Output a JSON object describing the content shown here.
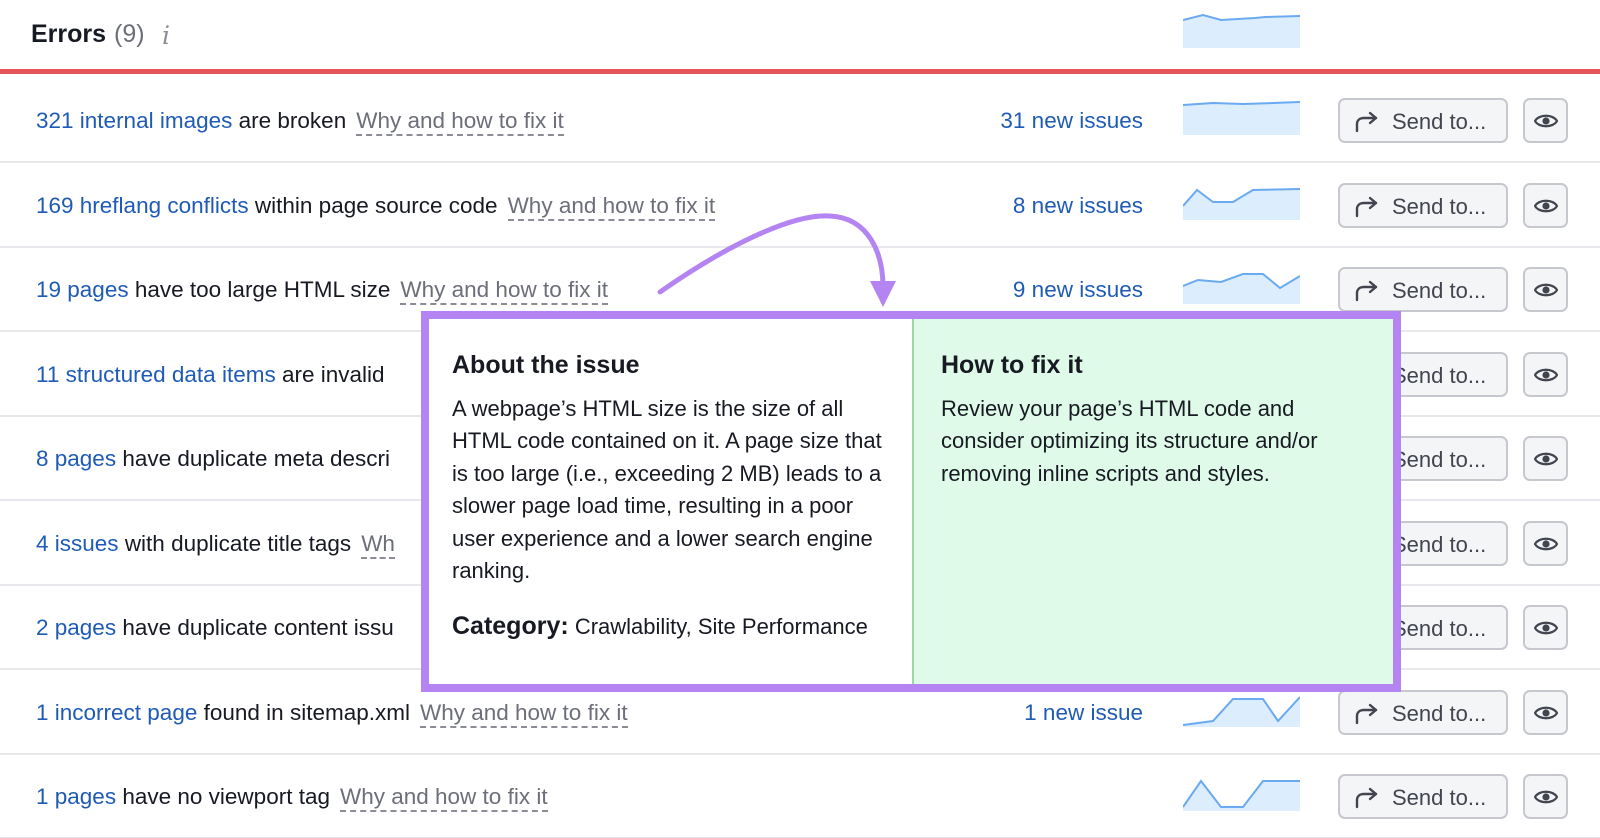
{
  "header": {
    "title": "Errors",
    "count": "(9)",
    "info_glyph": "i"
  },
  "rows": [
    {
      "link": "321 internal images",
      "text": "are broken",
      "why": "Why and how to fix it",
      "issues": "31 new issues",
      "send": "Send to..."
    },
    {
      "link": "169 hreflang conflicts",
      "text": "within page source code",
      "why": "Why and how to fix it",
      "issues": "8 new issues",
      "send": "Send to..."
    },
    {
      "link": "19 pages",
      "text": "have too large HTML size",
      "why": "Why and how to fix it",
      "issues": "9 new issues",
      "send": "Send to..."
    },
    {
      "link": "11 structured data items",
      "text": "are invalid",
      "why": "",
      "issues": "",
      "send": "Send to..."
    },
    {
      "link": "8 pages",
      "text": "have duplicate meta descri",
      "why": "",
      "issues": "",
      "send": "Send to..."
    },
    {
      "link": "4 issues",
      "text": "with duplicate title tags",
      "why": "Wh",
      "issues": "",
      "send": "Send to..."
    },
    {
      "link": "2 pages",
      "text": "have duplicate content issu",
      "why": "",
      "issues": "",
      "send": "Send to..."
    },
    {
      "link": "1 incorrect page",
      "text": "found in sitemap.xml",
      "why": "Why and how to fix it",
      "issues": "1 new issue",
      "send": "Send to..."
    },
    {
      "link": "1 pages",
      "text": "have no viewport tag",
      "why": "Why and how to fix it",
      "issues": "",
      "send": "Send to..."
    }
  ],
  "popup": {
    "about_title": "About the issue",
    "about_text": "A webpage’s HTML size is the size of all HTML code contained on it. A page size that is too large (i.e., exceeding 2 MB) leads to a slower page load time, resulting in a poor user experience and a lower search engine ranking.",
    "category_label": "Category:",
    "category_value": "Crawlability, Site Performance",
    "fix_title": "How to fix it",
    "fix_text": "Review your page’s HTML code and consider optimizing its structure and/or removing inline scripts and styles."
  },
  "colors": {
    "accent_red": "#e5545b",
    "link_blue": "#1f5bb6",
    "callout_purple": "#b384f2",
    "fix_green_bg": "#e0faea",
    "spark_fill": "#dcedfd",
    "spark_line": "#6aaaf0"
  },
  "icons": {
    "send": "share-arrow-icon",
    "eye": "eye-icon",
    "info": "info-icon"
  }
}
